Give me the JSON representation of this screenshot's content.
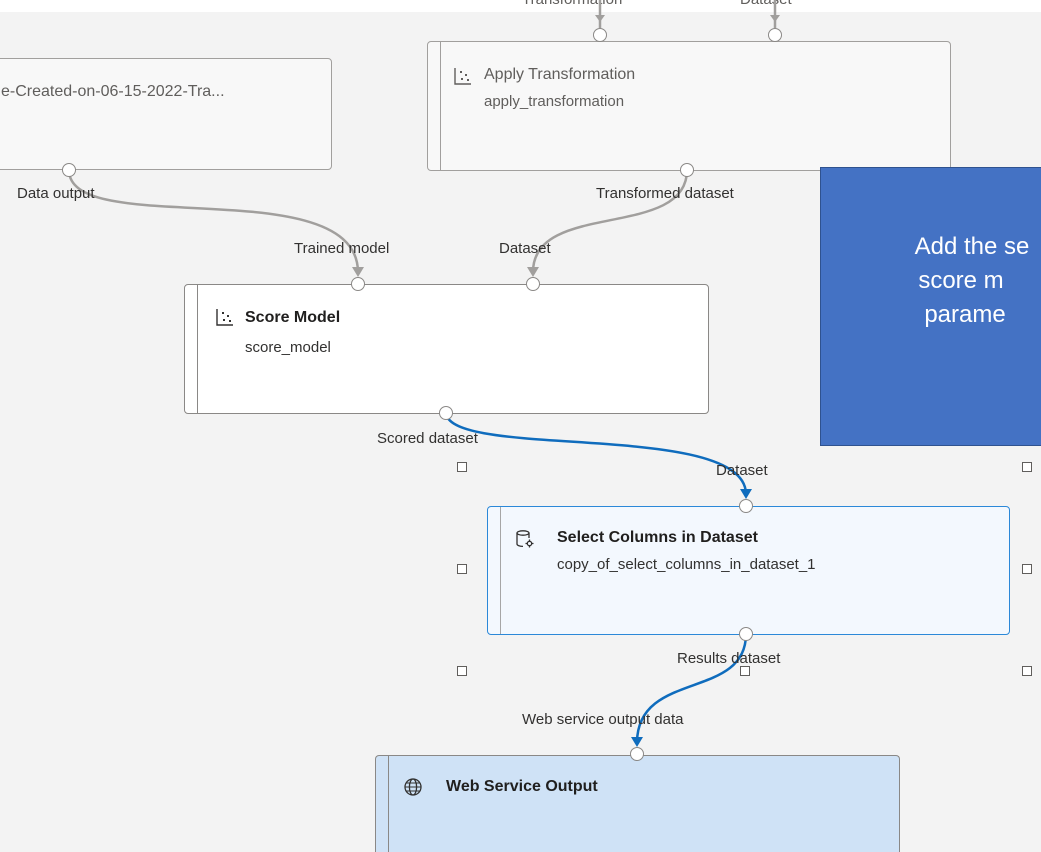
{
  "top_cut_labels": {
    "left": "Transformation",
    "right": "Dataset"
  },
  "data_node": {
    "title": "e-Created-on-06-15-2022-Tra...",
    "output_label": "Data output"
  },
  "apply_transformation": {
    "title": "Apply Transformation",
    "subtitle": "apply_transformation",
    "output_label": "Transformed dataset",
    "icon": "scatter-chart-icon"
  },
  "score_model": {
    "title": "Score Model",
    "subtitle": "score_model",
    "input_labels": [
      "Trained model",
      "Dataset"
    ],
    "output_label": "Scored dataset",
    "icon": "scatter-chart-icon"
  },
  "select_columns": {
    "title": "Select Columns in Dataset",
    "subtitle": "copy_of_select_columns_in_dataset_1",
    "input_label": "Dataset",
    "output_label": "Results dataset",
    "icon": "database-gear-icon"
  },
  "web_service_output": {
    "title": "Web Service Output",
    "input_label": "Web service output data",
    "icon": "globe-icon"
  },
  "callout": {
    "lines": [
      "Add the se",
      "score m",
      "parame"
    ]
  },
  "colors": {
    "canvas": "#f3f3f3",
    "accent_wire": "#0f6cbd",
    "selected_border": "#2b88d8",
    "output_fill": "#cfe2f6",
    "callout_fill": "#4472c4"
  }
}
